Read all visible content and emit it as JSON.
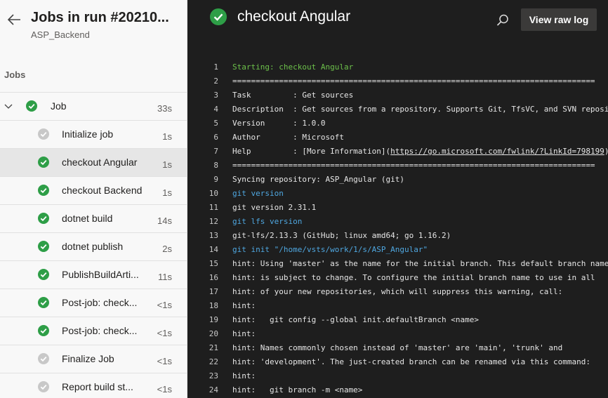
{
  "sidebar": {
    "title": "Jobs in run #20210...",
    "subtitle": "ASP_Backend",
    "section_label": "Jobs",
    "job": {
      "label": "Job",
      "duration": "33s",
      "status": "success"
    },
    "steps": [
      {
        "label": "Initialize job",
        "duration": "1s",
        "status": "skipped"
      },
      {
        "label": "checkout Angular",
        "duration": "1s",
        "status": "success",
        "selected": true
      },
      {
        "label": "checkout Backend",
        "duration": "1s",
        "status": "success"
      },
      {
        "label": "dotnet build",
        "duration": "14s",
        "status": "success"
      },
      {
        "label": "dotnet publish",
        "duration": "2s",
        "status": "success"
      },
      {
        "label": "PublishBuildArti...",
        "duration": "11s",
        "status": "success"
      },
      {
        "label": "Post-job: check...",
        "duration": "<1s",
        "status": "success"
      },
      {
        "label": "Post-job: check...",
        "duration": "<1s",
        "status": "success"
      },
      {
        "label": "Finalize Job",
        "duration": "<1s",
        "status": "skipped"
      },
      {
        "label": "Report build st...",
        "duration": "<1s",
        "status": "skipped"
      }
    ]
  },
  "header": {
    "title": "checkout Angular",
    "raw_log_label": "View raw log",
    "search_icon": "search-icon"
  },
  "colors": {
    "success": "#2e9e47",
    "skipped": "#c8c8c8",
    "log_green": "#6cc04a",
    "log_blue": "#4fa7e0"
  },
  "log": [
    {
      "n": "1",
      "text": "Starting: checkout Angular",
      "style": "green"
    },
    {
      "n": "2",
      "text": "==============================================================================",
      "style": ""
    },
    {
      "n": "3",
      "text": "Task         : Get sources",
      "style": ""
    },
    {
      "n": "4",
      "text": "Description  : Get sources from a repository. Supports Git, TfsVC, and SVN reposi",
      "style": ""
    },
    {
      "n": "5",
      "text": "Version      : 1.0.0",
      "style": ""
    },
    {
      "n": "6",
      "text": "Author       : Microsoft",
      "style": ""
    },
    {
      "n": "7",
      "text": "Help         : [More Information](",
      "link": "https://go.microsoft.com/fwlink/?LinkId=798199",
      "after": ")",
      "style": ""
    },
    {
      "n": "8",
      "text": "==============================================================================",
      "style": ""
    },
    {
      "n": "9",
      "text": "Syncing repository: ASP_Angular (git)",
      "style": ""
    },
    {
      "n": "10",
      "text": "git version",
      "style": "blue"
    },
    {
      "n": "11",
      "text": "git version 2.31.1",
      "style": ""
    },
    {
      "n": "12",
      "text": "git lfs version",
      "style": "blue"
    },
    {
      "n": "13",
      "text": "git-lfs/2.13.3 (GitHub; linux amd64; go 1.16.2)",
      "style": ""
    },
    {
      "n": "14",
      "text": "git init \"/home/vsts/work/1/s/ASP_Angular\"",
      "style": "blue"
    },
    {
      "n": "15",
      "text": "hint: Using 'master' as the name for the initial branch. This default branch name",
      "style": ""
    },
    {
      "n": "16",
      "text": "hint: is subject to change. To configure the initial branch name to use in all",
      "style": ""
    },
    {
      "n": "17",
      "text": "hint: of your new repositories, which will suppress this warning, call:",
      "style": ""
    },
    {
      "n": "18",
      "text": "hint:",
      "style": ""
    },
    {
      "n": "19",
      "text": "hint:   git config --global init.defaultBranch <name>",
      "style": ""
    },
    {
      "n": "20",
      "text": "hint:",
      "style": ""
    },
    {
      "n": "21",
      "text": "hint: Names commonly chosen instead of 'master' are 'main', 'trunk' and",
      "style": ""
    },
    {
      "n": "22",
      "text": "hint: 'development'. The just-created branch can be renamed via this command:",
      "style": ""
    },
    {
      "n": "23",
      "text": "hint:",
      "style": ""
    },
    {
      "n": "24",
      "text": "hint:   git branch -m <name>",
      "style": ""
    }
  ]
}
